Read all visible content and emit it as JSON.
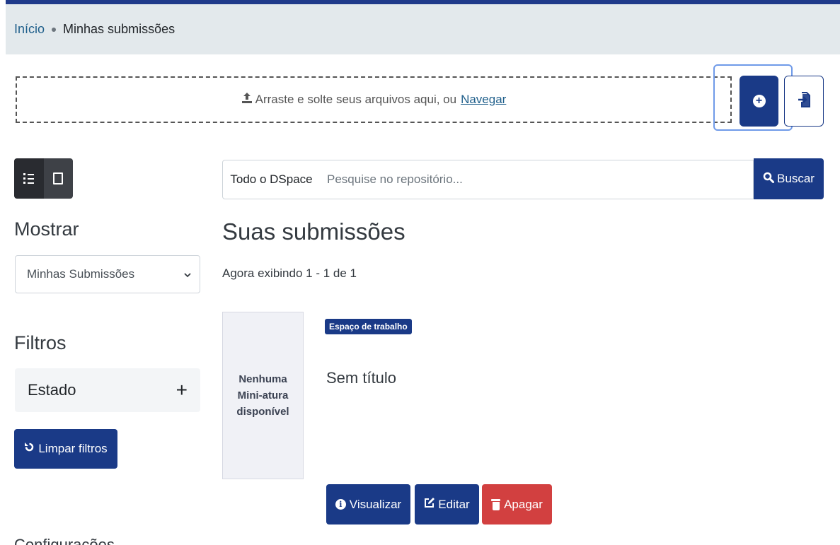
{
  "breadcrumb": {
    "home": "Início",
    "current": "Minhas submissões"
  },
  "upload": {
    "text": "Arraste e solte seus arquivos aqui, ou",
    "browse_link": "Navegar"
  },
  "search": {
    "scope": "Todo o DSpace",
    "placeholder": "Pesquise no repositório...",
    "button": "Buscar"
  },
  "sidebar": {
    "show_label": "Mostrar",
    "show_select": "Minhas Submissões",
    "filters_label": "Filtros",
    "filter_state": "Estado",
    "clear_button": "Limpar filtros",
    "partial_heading": "Configurações"
  },
  "main": {
    "heading": "Suas submissões",
    "showing": "Agora exibindo 1 - 1 de 1",
    "item": {
      "thumbnail_text": "Nenhuma Mini-atura disponível",
      "badge": "Espaço de trabalho",
      "title": "Sem título",
      "view_button": "Visualizar",
      "edit_button": "Editar",
      "delete_button": "Apagar"
    }
  },
  "colors": {
    "primary": "#1a3a87",
    "danger": "#d24040",
    "breadcrumb_bg": "#e3e9ec"
  }
}
